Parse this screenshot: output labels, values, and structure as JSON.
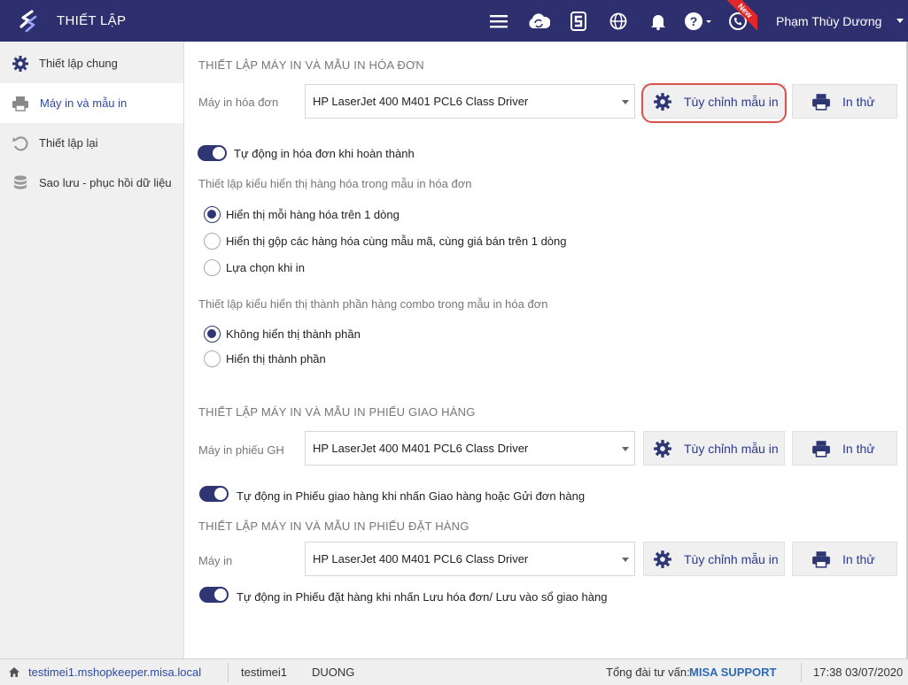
{
  "header": {
    "title": "THIẾT LẬP",
    "user_name": "Phạm Thùy Dương",
    "new_badge": "New",
    "icons": [
      "menu-icon",
      "cloud-sync-icon",
      "s-logo-icon",
      "globe-icon",
      "bell-icon",
      "help-icon",
      "phone-icon"
    ]
  },
  "sidebar": {
    "items": [
      {
        "label": "Thiết lập chung",
        "icon": "gear-icon"
      },
      {
        "label": "Máy in và mẫu in",
        "icon": "printer-icon"
      },
      {
        "label": "Thiết lập lại",
        "icon": "reset-icon"
      },
      {
        "label": "Sao lưu - phục hồi dữ liệu",
        "icon": "database-icon"
      }
    ]
  },
  "invoice": {
    "section_title": "THIẾT LẬP MÁY IN VÀ MẪU IN HÓA ĐƠN",
    "printer_label": "Máy in hóa đơn",
    "printer_value": "HP LaserJet 400 M401 PCL6 Class Driver",
    "customize_label": "Tùy chỉnh mẫu in",
    "test_label": "In thử",
    "auto_print_label": "Tự động in hóa đơn khi hoàn thành",
    "display_title": "Thiết lập kiểu hiển thị hàng hóa trong mẫu in hóa đơn",
    "display_options": [
      "Hiển thị mỗi hàng hóa trên 1 dòng",
      "Hiển thị gộp các hàng hóa cùng mẫu mã, cùng giá bán trên 1 dòng",
      "Lựa chọn khi in"
    ],
    "combo_title": "Thiết lập kiểu hiển thị thành phần hàng combo trong mẫu in hóa đơn",
    "combo_options": [
      "Không hiển thị thành phần",
      "Hiển thị thành phần"
    ]
  },
  "delivery": {
    "section_title": "THIẾT LẬP MÁY IN VÀ MẪU IN PHIẾU GIAO HÀNG",
    "printer_label": "Máy in phiếu GH",
    "printer_value": "HP LaserJet 400 M401 PCL6 Class Driver",
    "customize_label": "Tùy chỉnh mẫu in",
    "test_label": "In thử",
    "auto_print_label": "Tự động in Phiếu giao hàng khi nhấn Giao hàng hoặc Gửi đơn hàng"
  },
  "order": {
    "section_title": "THIẾT LẬP MÁY IN VÀ MẪU IN PHIẾU ĐẶT HÀNG",
    "printer_label": "Máy in",
    "printer_value": "HP LaserJet 400 M401 PCL6 Class Driver",
    "customize_label": "Tùy chỉnh mẫu in",
    "test_label": "In thử",
    "auto_print_label": "Tự động in Phiếu đặt hàng khi nhấn Lưu hóa đơn/ Lưu vào sổ giao hàng"
  },
  "status": {
    "domain": "testimei1.mshopkeeper.misa.local",
    "shop": "testimei1",
    "user": "DUONG",
    "hotline_label": "Tổng đài tư vấn:",
    "hotline_value": "MISA SUPPORT",
    "datetime": "17:38 03/07/2020"
  },
  "colors": {
    "header_bg": "#2e2f6e",
    "accent": "#2d4ba3",
    "highlight": "#d9534f",
    "toggle_on": "#2e3673"
  }
}
